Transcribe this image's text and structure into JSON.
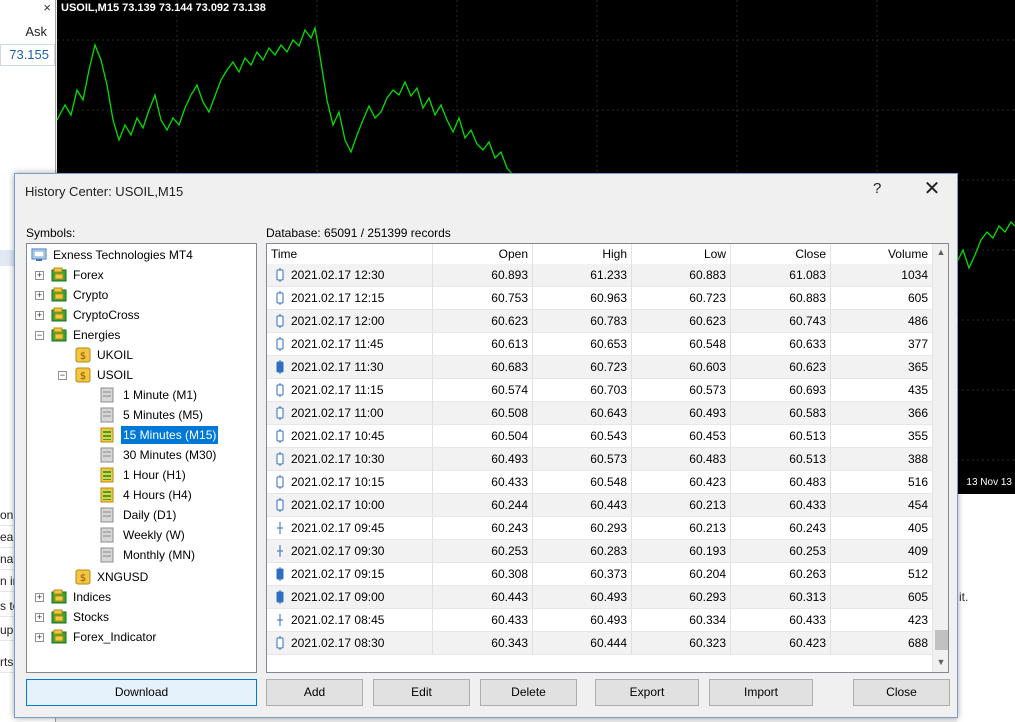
{
  "market_watch": {
    "close_glyph": "×",
    "ask_label": "Ask",
    "ask_price": "73.155"
  },
  "terminal_fragments": [
    "on",
    "eak",
    "nat",
    "n ir",
    "s te",
    "up",
    "rts"
  ],
  "terminal_right_text": "it.",
  "chart": {
    "title": "USOIL,M15  73.139 73.144 73.092 73.138",
    "date_label": "13 Nov 13",
    "line_color": "#00e000",
    "background": "#000000"
  },
  "dialog": {
    "title": "History Center: USOIL,M15",
    "help_glyph": "?",
    "close_glyph": "✕",
    "symbols_label": "Symbols:",
    "database_label": "Database: 65091 / 251399 records"
  },
  "tree": {
    "root": "Exness Technologies MT4",
    "groups": [
      "Forex",
      "Crypto",
      "CryptoCross",
      "Energies"
    ],
    "energies_symbols": [
      "UKOIL",
      "USOIL"
    ],
    "timeframes": [
      {
        "label": "1 Minute (M1)",
        "has_data": false
      },
      {
        "label": "5 Minutes (M5)",
        "has_data": false
      },
      {
        "label": "15 Minutes (M15)",
        "has_data": true,
        "selected": true
      },
      {
        "label": "30 Minutes (M30)",
        "has_data": false
      },
      {
        "label": "1 Hour (H1)",
        "has_data": true
      },
      {
        "label": "4 Hours (H4)",
        "has_data": true
      },
      {
        "label": "Daily (D1)",
        "has_data": false
      },
      {
        "label": "Weekly (W)",
        "has_data": false
      },
      {
        "label": "Monthly (MN)",
        "has_data": false
      }
    ],
    "after_usoil": "XNGUSD",
    "groups_after": [
      "Indices",
      "Stocks",
      "Forex_Indicator"
    ],
    "expand_collapsed": "+",
    "expand_open": "−"
  },
  "table": {
    "headers": [
      "Time",
      "Open",
      "High",
      "Low",
      "Close",
      "Volume"
    ],
    "rows": [
      {
        "time": "2021.02.17 12:30",
        "open": "60.893",
        "high": "61.233",
        "low": "60.883",
        "close": "61.083",
        "volume": "1034",
        "candle": "bull"
      },
      {
        "time": "2021.02.17 12:15",
        "open": "60.753",
        "high": "60.963",
        "low": "60.723",
        "close": "60.883",
        "volume": "605",
        "candle": "bull"
      },
      {
        "time": "2021.02.17 12:00",
        "open": "60.623",
        "high": "60.783",
        "low": "60.623",
        "close": "60.743",
        "volume": "486",
        "candle": "bull"
      },
      {
        "time": "2021.02.17 11:45",
        "open": "60.613",
        "high": "60.653",
        "low": "60.548",
        "close": "60.633",
        "volume": "377",
        "candle": "bull"
      },
      {
        "time": "2021.02.17 11:30",
        "open": "60.683",
        "high": "60.723",
        "low": "60.603",
        "close": "60.623",
        "volume": "365",
        "candle": "bear"
      },
      {
        "time": "2021.02.17 11:15",
        "open": "60.574",
        "high": "60.703",
        "low": "60.573",
        "close": "60.693",
        "volume": "435",
        "candle": "bull"
      },
      {
        "time": "2021.02.17 11:00",
        "open": "60.508",
        "high": "60.643",
        "low": "60.493",
        "close": "60.583",
        "volume": "366",
        "candle": "bull"
      },
      {
        "time": "2021.02.17 10:45",
        "open": "60.504",
        "high": "60.543",
        "low": "60.453",
        "close": "60.513",
        "volume": "355",
        "candle": "bull"
      },
      {
        "time": "2021.02.17 10:30",
        "open": "60.493",
        "high": "60.573",
        "low": "60.483",
        "close": "60.513",
        "volume": "388",
        "candle": "bull"
      },
      {
        "time": "2021.02.17 10:15",
        "open": "60.433",
        "high": "60.548",
        "low": "60.423",
        "close": "60.483",
        "volume": "516",
        "candle": "bull"
      },
      {
        "time": "2021.02.17 10:00",
        "open": "60.244",
        "high": "60.443",
        "low": "60.213",
        "close": "60.433",
        "volume": "454",
        "candle": "bull"
      },
      {
        "time": "2021.02.17 09:45",
        "open": "60.243",
        "high": "60.293",
        "low": "60.213",
        "close": "60.243",
        "volume": "405",
        "candle": "doji"
      },
      {
        "time": "2021.02.17 09:30",
        "open": "60.253",
        "high": "60.283",
        "low": "60.193",
        "close": "60.253",
        "volume": "409",
        "candle": "doji"
      },
      {
        "time": "2021.02.17 09:15",
        "open": "60.308",
        "high": "60.373",
        "low": "60.204",
        "close": "60.263",
        "volume": "512",
        "candle": "bear"
      },
      {
        "time": "2021.02.17 09:00",
        "open": "60.443",
        "high": "60.493",
        "low": "60.293",
        "close": "60.313",
        "volume": "605",
        "candle": "bear"
      },
      {
        "time": "2021.02.17 08:45",
        "open": "60.433",
        "high": "60.493",
        "low": "60.334",
        "close": "60.433",
        "volume": "423",
        "candle": "doji"
      },
      {
        "time": "2021.02.17 08:30",
        "open": "60.343",
        "high": "60.444",
        "low": "60.323",
        "close": "60.423",
        "volume": "688",
        "candle": "bull"
      }
    ],
    "scroll_up_glyph": "▲",
    "scroll_down_glyph": "▼"
  },
  "buttons": {
    "download": "Download",
    "add": "Add",
    "edit": "Edit",
    "delete": "Delete",
    "export": "Export",
    "import": "Import",
    "close": "Close"
  },
  "colors": {
    "selection": "#0078d7",
    "candle_bear": "#2f6fc0",
    "candle_outline": "#2f6fc0"
  }
}
